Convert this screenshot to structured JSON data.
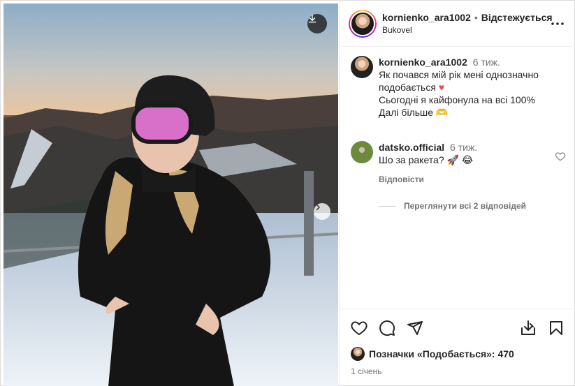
{
  "header": {
    "username": "kornienko_ara1002",
    "separator": "•",
    "follow_label": "Відстежується",
    "location": "Bukovel",
    "more_icon": "more-horizontal-icon"
  },
  "photo": {
    "download_icon": "download-icon",
    "next_icon": "chevron-right-icon"
  },
  "caption": {
    "username": "kornienko_ara1002",
    "time": "6 тиж.",
    "lines": [
      "Як почався мій рік мені однозначно подобається",
      "Сьогодні я кайфонула на всі 100%",
      "Далі більше 🫶"
    ],
    "heart": "♥"
  },
  "comments": [
    {
      "username": "datsko.official",
      "time": "6 тиж.",
      "text": "Шо за ракета? 🚀 😂",
      "reply_label": "Відповісти"
    }
  ],
  "view_replies_label": "Переглянути всі 2 відповідей",
  "actions": {
    "like_icon": "heart-icon",
    "comment_icon": "comment-icon",
    "share_icon": "share-icon",
    "download_icon": "download-to-device-icon",
    "save_icon": "bookmark-icon"
  },
  "likes": {
    "label": "Позначки «Подобається»: 470",
    "count": 470
  },
  "date": "1 січень"
}
